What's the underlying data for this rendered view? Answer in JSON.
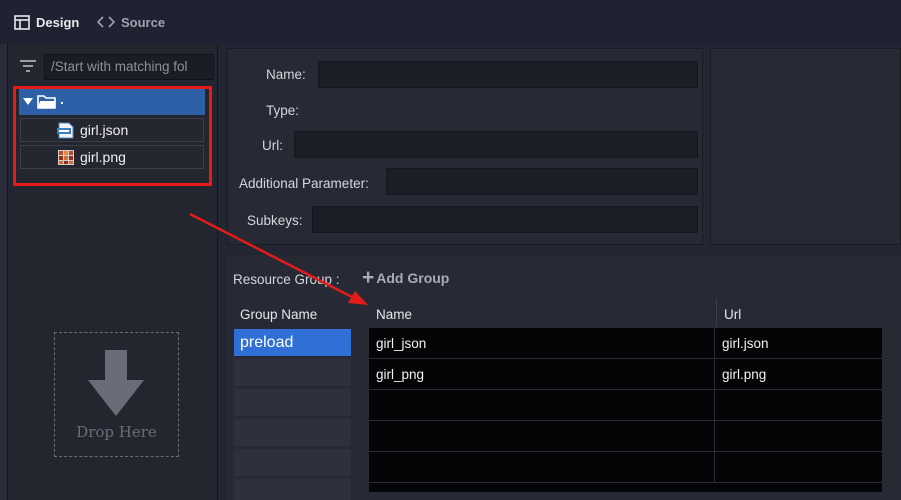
{
  "tabs": [
    {
      "label": "Design",
      "icon": "layout-icon",
      "active": true
    },
    {
      "label": "Source",
      "icon": "code-brackets-icon",
      "active": false
    }
  ],
  "tree": {
    "search_placeholder": "/Start with matching fol",
    "root_label": ".",
    "items": [
      {
        "label": "girl.json",
        "icon": "json-file-icon"
      },
      {
        "label": "girl.png",
        "icon": "image-file-icon"
      }
    ],
    "drop_text": "Drop Here"
  },
  "properties": {
    "name_label": "Name:",
    "name_value": "",
    "type_label": "Type:",
    "url_label": "Url:",
    "url_value": "",
    "additional_label": "Additional Parameter:",
    "additional_value": "",
    "subkeys_label": "Subkeys:",
    "subkeys_value": ""
  },
  "resource_group": {
    "label": "Resource Group :",
    "add_group": "Add Group",
    "columns": {
      "group_name": "Group Name",
      "name": "Name",
      "url": "Url"
    },
    "groups": [
      "preload"
    ],
    "resources": [
      {
        "name": "girl_json",
        "url": "girl.json"
      },
      {
        "name": "girl_png",
        "url": "girl.png"
      },
      {
        "name": "",
        "url": ""
      },
      {
        "name": "",
        "url": ""
      },
      {
        "name": "",
        "url": ""
      }
    ]
  },
  "annotation_color": "#e41b1b",
  "selection_color": "#2f6fd6"
}
